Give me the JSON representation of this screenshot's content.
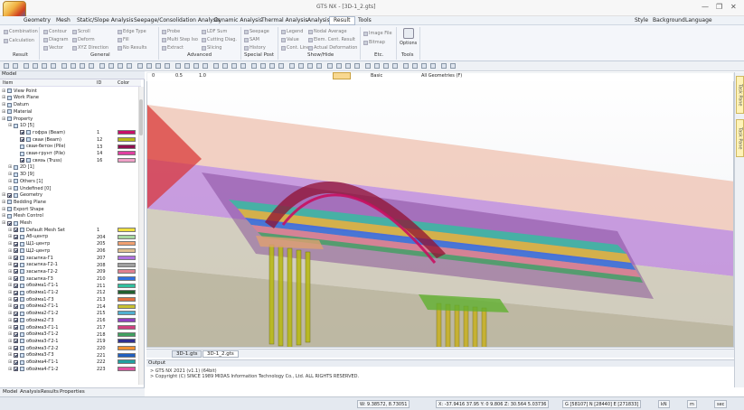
{
  "app": {
    "title": "GTS NX - [3D-1_2.gts]",
    "win_min": "—",
    "win_max": "❐",
    "win_close": "✕"
  },
  "menu": {
    "items": [
      "Geometry",
      "Mesh",
      "Static/Slope Analysis",
      "Seepage/Consolidation Analysis",
      "Dynamic Analysis",
      "Thermal Analysis",
      "Analysis",
      "Result",
      "Tools"
    ],
    "right": [
      "Style",
      "Background",
      "Language"
    ]
  },
  "ribbon": {
    "result_items": [
      "Combination",
      "Calculation"
    ],
    "general_items": [
      "Contour",
      "Diagram",
      "Vector",
      "Scroll",
      "Deform",
      "XYZ Direction",
      "Edge Type",
      "Fill",
      "No Results"
    ],
    "advanced_items": [
      "Probe",
      "Multi Step Iso",
      "Extract",
      "LDF Sum",
      "Cutting Diag.",
      "Slicing"
    ],
    "special_items": [
      "Seepage",
      "SAM",
      "History"
    ],
    "showhide_items": [
      "Legend",
      "Value",
      "Cont. Line",
      "Nodal Average",
      "Elem. Cent. Result",
      "Actual Deformation"
    ],
    "etc_items": [
      "Image File",
      "Bitmap"
    ],
    "tools_items": [
      "Options"
    ],
    "groups": [
      "Result",
      "General",
      "Advanced",
      "Special Post",
      "Show/Hide",
      "Etc.",
      "Tools"
    ]
  },
  "panel": {
    "title": "Model",
    "col_item": "Item",
    "col_id": "ID",
    "col_color": "Color",
    "tree": [
      {
        "label": "View Point",
        "indent": 1,
        "check": false,
        "id": "",
        "color": ""
      },
      {
        "label": "Work Plane",
        "indent": 1,
        "check": false,
        "id": "",
        "color": ""
      },
      {
        "label": "Datum",
        "indent": 1,
        "check": false,
        "id": "",
        "color": ""
      },
      {
        "label": "Material",
        "indent": 1,
        "check": false,
        "id": "",
        "color": ""
      },
      {
        "label": "Property",
        "indent": 1,
        "check": false,
        "id": "",
        "color": ""
      },
      {
        "label": "1D [5]",
        "indent": 2,
        "check": false,
        "id": "",
        "color": ""
      },
      {
        "label": "гофра (Beam)",
        "indent": 3,
        "check": true,
        "id": "1",
        "color": "#c8106a"
      },
      {
        "label": "сваи (Beam)",
        "indent": 3,
        "check": true,
        "id": "12",
        "color": "#b8b818"
      },
      {
        "label": "сваи-бетон (Pile)",
        "indent": 3,
        "check": false,
        "id": "13",
        "color": "#901050"
      },
      {
        "label": "сваи-грунт (Pile)",
        "indent": 3,
        "check": false,
        "id": "14",
        "color": "#e040a0"
      },
      {
        "label": "связь (Truss)",
        "indent": 3,
        "check": true,
        "id": "16",
        "color": "#f0a0c8"
      },
      {
        "label": "2D [1]",
        "indent": 2,
        "check": false,
        "id": "",
        "color": ""
      },
      {
        "label": "3D [9]",
        "indent": 2,
        "check": false,
        "id": "",
        "color": ""
      },
      {
        "label": "Others [1]",
        "indent": 2,
        "check": false,
        "id": "",
        "color": ""
      },
      {
        "label": "Undefined [0]",
        "indent": 2,
        "check": false,
        "id": "",
        "color": ""
      },
      {
        "label": "Geometry",
        "indent": 1,
        "check": true,
        "id": "",
        "color": ""
      },
      {
        "label": "Bedding Plane",
        "indent": 1,
        "check": false,
        "id": "",
        "color": ""
      },
      {
        "label": "Export Shape",
        "indent": 1,
        "check": false,
        "id": "",
        "color": ""
      },
      {
        "label": "Mesh Control",
        "indent": 1,
        "check": false,
        "id": "",
        "color": ""
      },
      {
        "label": "Mesh",
        "indent": 1,
        "check": true,
        "id": "",
        "color": ""
      },
      {
        "label": "Default Mesh Set",
        "indent": 2,
        "check": true,
        "id": "1",
        "color": "#f0e040"
      },
      {
        "label": "Аб-центр",
        "indent": 2,
        "check": true,
        "id": "204",
        "color": "#a8d8a0"
      },
      {
        "label": "Щ1-центр",
        "indent": 2,
        "check": true,
        "id": "205",
        "color": "#f0a070"
      },
      {
        "label": "Щ2-центр",
        "indent": 2,
        "check": true,
        "id": "206",
        "color": "#e0c090"
      },
      {
        "label": "засыпка-Г1",
        "indent": 2,
        "check": true,
        "id": "207",
        "color": "#b070e0"
      },
      {
        "label": "засыпка-Г2-1",
        "indent": 2,
        "check": true,
        "id": "208",
        "color": "#a0a0a0"
      },
      {
        "label": "засыпка-Г2-2",
        "indent": 2,
        "check": true,
        "id": "209",
        "color": "#e08090"
      },
      {
        "label": "засыпка-Г3",
        "indent": 2,
        "check": true,
        "id": "210",
        "color": "#3070e0"
      },
      {
        "label": "обойма1-Г1-1",
        "indent": 2,
        "check": true,
        "id": "211",
        "color": "#30c0a0"
      },
      {
        "label": "обойма1-Г1-2",
        "indent": 2,
        "check": true,
        "id": "212",
        "color": "#206030"
      },
      {
        "label": "обойма1-Г3",
        "indent": 2,
        "check": true,
        "id": "213",
        "color": "#e07040"
      },
      {
        "label": "обойма2-Г1-1",
        "indent": 2,
        "check": true,
        "id": "214",
        "color": "#c8c030"
      },
      {
        "label": "обойма2-Г1-2",
        "indent": 2,
        "check": true,
        "id": "215",
        "color": "#50b0d0"
      },
      {
        "label": "обойма2-Г3",
        "indent": 2,
        "check": true,
        "id": "216",
        "color": "#9040c0"
      },
      {
        "label": "обойма3-Г1-1",
        "indent": 2,
        "check": true,
        "id": "217",
        "color": "#d04080"
      },
      {
        "label": "обойма3-Г1-2",
        "indent": 2,
        "check": true,
        "id": "218",
        "color": "#40a060"
      },
      {
        "label": "обойма3-Г2-1",
        "indent": 2,
        "check": true,
        "id": "219",
        "color": "#303090"
      },
      {
        "label": "обойма3-Г2-2",
        "indent": 2,
        "check": true,
        "id": "220",
        "color": "#f09030"
      },
      {
        "label": "обойма3-Г3",
        "indent": 2,
        "check": true,
        "id": "221",
        "color": "#2060c0"
      },
      {
        "label": "обойма4-Г1-1",
        "indent": 2,
        "check": true,
        "id": "222",
        "color": "#20a0a0"
      },
      {
        "label": "обойма4-Г1-2",
        "indent": 2,
        "check": true,
        "id": "223",
        "color": "#e050a0"
      }
    ],
    "tabs": [
      "Model",
      "Analysis",
      "Results",
      "Properties"
    ]
  },
  "viewport": {
    "tb_label_basic": "Basic",
    "tb_label_geom": "All Geometries (F)",
    "scale_labels": [
      "0",
      "0.5",
      "1.0"
    ],
    "doc_tabs": [
      "3D-1.gts",
      "3D-1_2.gts"
    ]
  },
  "output": {
    "title": "Output",
    "lines": [
      "> GTS NX 2021 (v1.1) (64bit)",
      "> Copyright (C) SINCE 1989 MIDAS Information Technology Co., Ltd. ALL RIGHTS RESERVED."
    ]
  },
  "sidetabs": [
    "Task Pane",
    "Task Pane"
  ],
  "status": {
    "w": "W: 9.38572, 8.73051",
    "xyz": "X: -37.9416 37.95 Y: 0 9.806 Z: 30.564 5.03736",
    "g": "G [58107] N [28440] E [271833]",
    "unit1": "kN",
    "unit2": "m",
    "unit3": "sec"
  },
  "colors": {
    "accent": "#f0b040",
    "ribbon_bg": "#f4f6fa"
  }
}
